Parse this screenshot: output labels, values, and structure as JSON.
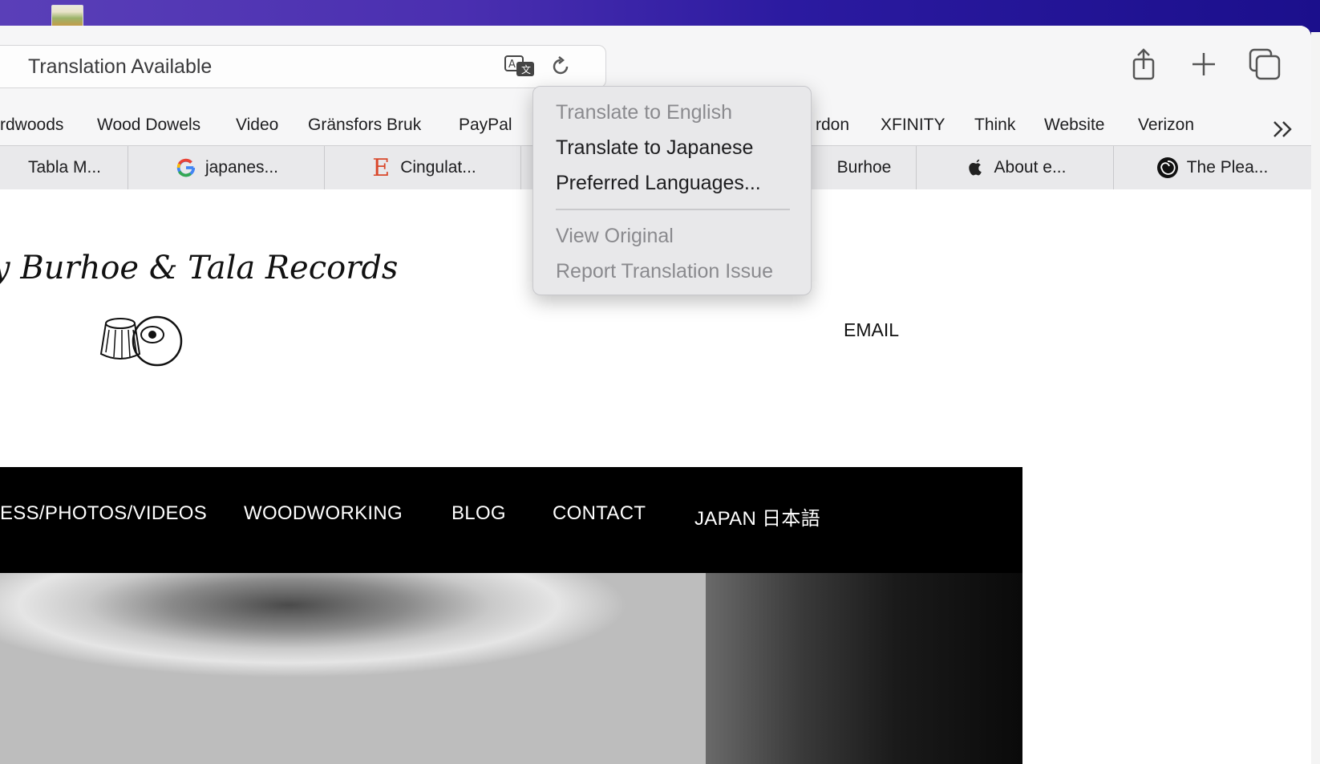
{
  "browser": {
    "address_bar": {
      "text": "Translation Available"
    },
    "bookmarks": [
      "rdwoods",
      "Wood Dowels",
      "Video",
      "Gränsfors Bruk",
      "PayPal",
      "rdon",
      "XFINITY",
      "Think",
      "Website",
      "Verizon"
    ],
    "tabs": [
      {
        "label": "Tabla M...",
        "icon": "none"
      },
      {
        "label": "japanes...",
        "icon": "google-icon"
      },
      {
        "label": "Cingulat...",
        "icon": "e-icon"
      },
      {
        "label": "Burhoe",
        "icon": "none"
      },
      {
        "label": "About e...",
        "icon": "apple-icon"
      },
      {
        "label": "The Plea...",
        "icon": "spiral-icon"
      }
    ]
  },
  "translate_menu": {
    "items": [
      {
        "label": "Translate to English",
        "enabled": false
      },
      {
        "label": "Translate to Japanese",
        "enabled": true
      },
      {
        "label": "Preferred Languages...",
        "enabled": true
      },
      {
        "label": "View Original",
        "enabled": false
      },
      {
        "label": "Report Translation Issue",
        "enabled": false
      }
    ]
  },
  "page": {
    "logo_text": "y Burhoe & Tala Records",
    "email_link": "EMAIL",
    "nav": [
      "ESS/PHOTOS/VIDEOS",
      "WOODWORKING",
      "BLOG",
      "CONTACT",
      "JAPAN 日本語"
    ]
  }
}
